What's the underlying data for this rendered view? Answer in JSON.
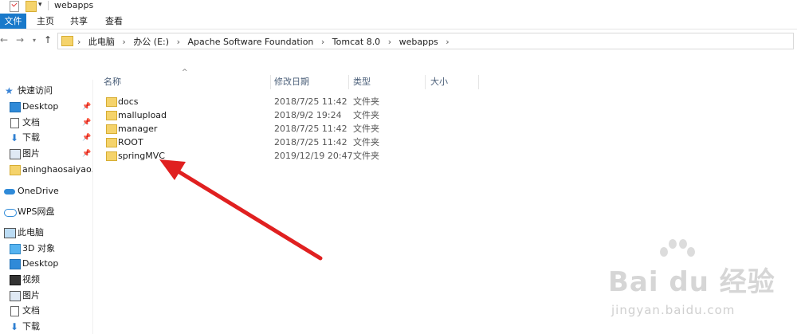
{
  "window": {
    "title": "webapps"
  },
  "ribbon": {
    "tabs": [
      "文件",
      "主页",
      "共享",
      "查看"
    ]
  },
  "address": {
    "crumbs": [
      "此电脑",
      "办公 (E:)",
      "Apache Software Foundation",
      "Tomcat 8.0",
      "webapps"
    ]
  },
  "sidebar": {
    "items": [
      {
        "label": "快速访问",
        "icon": "star-icon"
      },
      {
        "label": "Desktop",
        "icon": "desktop-icon",
        "pinned": true
      },
      {
        "label": "文档",
        "icon": "document-icon",
        "pinned": true
      },
      {
        "label": "下载",
        "icon": "download-icon",
        "pinned": true
      },
      {
        "label": "图片",
        "icon": "picture-icon",
        "pinned": true
      },
      {
        "label": "aninghaosaiyao.sp",
        "icon": "folder-icon"
      },
      {
        "label": "OneDrive",
        "icon": "cloud-icon"
      },
      {
        "label": "WPS网盘",
        "icon": "wps-cloud-icon"
      },
      {
        "label": "此电脑",
        "icon": "computer-icon"
      },
      {
        "label": "3D 对象",
        "icon": "3d-objects-icon"
      },
      {
        "label": "Desktop",
        "icon": "desktop-icon"
      },
      {
        "label": "视频",
        "icon": "video-icon"
      },
      {
        "label": "图片",
        "icon": "picture-icon"
      },
      {
        "label": "文档",
        "icon": "document-icon"
      },
      {
        "label": "下载",
        "icon": "download-icon"
      }
    ]
  },
  "filelist": {
    "columns": [
      "名称",
      "修改日期",
      "类型",
      "大小"
    ],
    "rows": [
      {
        "name": "docs",
        "date": "2018/7/25 11:42",
        "type": "文件夹"
      },
      {
        "name": "mallupload",
        "date": "2018/9/2 19:24",
        "type": "文件夹"
      },
      {
        "name": "manager",
        "date": "2018/7/25 11:42",
        "type": "文件夹"
      },
      {
        "name": "ROOT",
        "date": "2018/7/25 11:42",
        "type": "文件夹"
      },
      {
        "name": "springMVC",
        "date": "2019/12/19 20:47",
        "type": "文件夹"
      }
    ]
  },
  "annotation": {
    "arrow_color": "#e02020",
    "target": "springMVC"
  },
  "watermark": {
    "logo": "Bai du 经验",
    "url": "jingyan.baidu.com"
  },
  "colors": {
    "accent": "#1979ca",
    "folder": "#f5d36b"
  }
}
